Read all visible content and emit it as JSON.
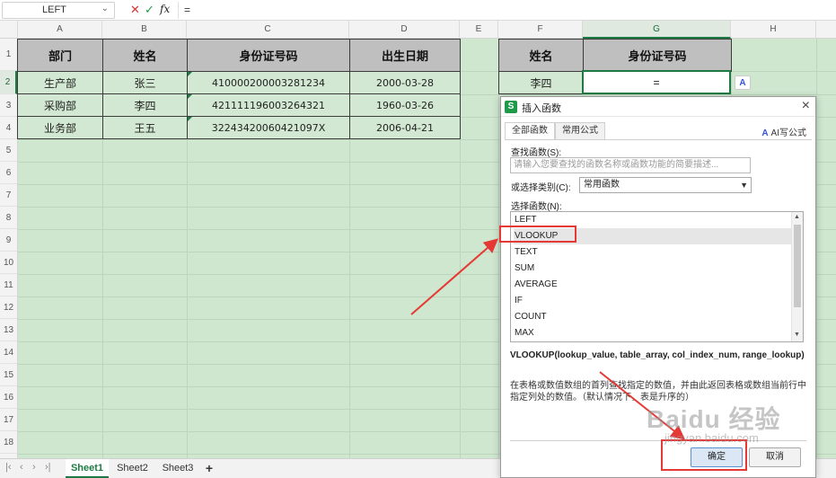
{
  "formula_bar": {
    "name_box": "LEFT",
    "cancel_icon": "✕",
    "confirm_icon": "✓",
    "fx_label": "fx",
    "formula": "="
  },
  "columns": [
    "A",
    "B",
    "C",
    "D",
    "E",
    "F",
    "G",
    "H"
  ],
  "rows": [
    "1",
    "2",
    "3",
    "4",
    "5",
    "6",
    "7",
    "8",
    "9",
    "10",
    "11",
    "12",
    "13",
    "14",
    "15",
    "16",
    "17",
    "18"
  ],
  "table1": {
    "headers": [
      "部门",
      "姓名",
      "身份证号码",
      "出生日期"
    ],
    "rows": [
      [
        "生产部",
        "张三",
        "410000200003281234",
        "2000-03-28"
      ],
      [
        "采购部",
        "李四",
        "421111196003264321",
        "1960-03-26"
      ],
      [
        "业务部",
        "王五",
        "32243420060421097X",
        "2006-04-21"
      ]
    ]
  },
  "table2": {
    "headers": [
      "姓名",
      "身份证号码"
    ],
    "name": "李四",
    "value": "="
  },
  "sheet_tabs": [
    "Sheet1",
    "Sheet2",
    "Sheet3"
  ],
  "add_sheet": "+",
  "dialog": {
    "title": "插入函数",
    "icon_letter": "S",
    "close": "×",
    "tabs": [
      "全部函数",
      "常用公式"
    ],
    "ai_write": "AI写公式",
    "search_label": "查找函数(S):",
    "search_placeholder": "请输入您要查找的函数名称或函数功能的简要描述...",
    "category_label": "或选择类别(C):",
    "category_value": "常用函数",
    "select_label": "选择函数(N):",
    "functions": [
      "LEFT",
      "VLOOKUP",
      "TEXT",
      "SUM",
      "AVERAGE",
      "IF",
      "COUNT",
      "MAX"
    ],
    "selected_function": "VLOOKUP",
    "syntax": "VLOOKUP(lookup_value, table_array, col_index_num, range_lookup)",
    "description": "在表格或数值数组的首列查找指定的数值，并由此返回表格或数组当前行中指定列处的数值。（默认情况下，表是升序的）",
    "ok_label": "确定",
    "cancel_label": "取消"
  },
  "watermark": {
    "main": "Baidu 经验",
    "sub": "jingyan.baidu.com"
  },
  "colors": {
    "grid_bg": "#cfe6cf",
    "header_fill": "#bfbfbf",
    "accent_green": "#1e7a44",
    "annotation_red": "#e53935"
  }
}
